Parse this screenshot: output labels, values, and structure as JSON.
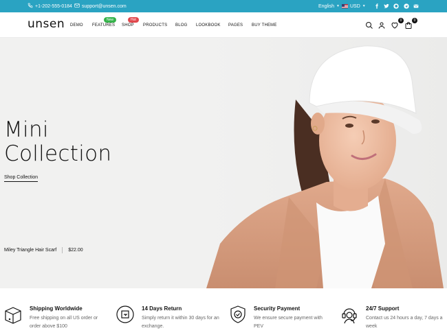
{
  "topbar": {
    "phone": "+1-202-555-0184",
    "email": "support@unsen.com",
    "language": "English",
    "currency": "USD",
    "social_icons": [
      "facebook-icon",
      "twitter-icon",
      "pinterest-icon",
      "telegram-icon",
      "email-icon"
    ],
    "bg_color": "#2aa3c2"
  },
  "header": {
    "logo": "unsen",
    "nav": [
      "DEMO",
      "FEATURES",
      "SHOP",
      "PRODUCTS",
      "BLOG",
      "LOOKBOOK",
      "PAGES",
      "BUY THEME"
    ],
    "badges": {
      "features": "New",
      "shop": "Hot"
    },
    "wishlist_count": "0",
    "cart_count": "0"
  },
  "hero": {
    "title_line1": "Mini",
    "title_line2": "Collection",
    "cta": "Shop Collection",
    "product_name": "Miley Triangle Hair Scarf",
    "product_price": "$22.00"
  },
  "features": [
    {
      "icon": "box-icon",
      "title": "Shipping Worldwide",
      "desc": "Free shipping on all US order or order above $100"
    },
    {
      "icon": "return-icon",
      "title": "14 Days Return",
      "desc": "Simply return it within 30 days for an exchange."
    },
    {
      "icon": "shield-icon",
      "title": "Security Payment",
      "desc": "We ensure secure payment with PEV"
    },
    {
      "icon": "headset-icon",
      "title": "24/7 Support",
      "desc": "Contact us 24 hours a day, 7 days a week"
    }
  ]
}
